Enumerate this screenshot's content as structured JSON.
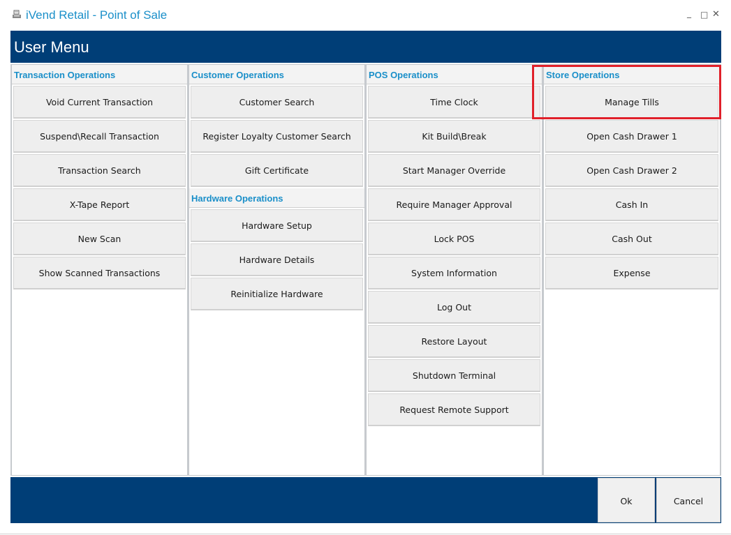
{
  "window": {
    "title": "iVend Retail - Point of Sale",
    "app_icon": "pos-receipt-icon",
    "controls": {
      "minimize": "_",
      "maximize": "□",
      "close": "✕"
    }
  },
  "header": {
    "title": "User Menu"
  },
  "columns": [
    {
      "sections": [
        {
          "title": "Transaction Operations",
          "buttons": [
            "Void Current Transaction",
            "Suspend\\Recall Transaction",
            "Transaction Search",
            "X-Tape Report",
            "New Scan",
            "Show Scanned Transactions"
          ]
        }
      ]
    },
    {
      "sections": [
        {
          "title": "Customer Operations",
          "buttons": [
            "Customer Search",
            "Register Loyalty Customer Search",
            "Gift Certificate"
          ]
        },
        {
          "title": "Hardware Operations",
          "buttons": [
            "Hardware Setup",
            "Hardware Details",
            "Reinitialize Hardware"
          ]
        }
      ]
    },
    {
      "sections": [
        {
          "title": "POS Operations",
          "buttons": [
            "Time Clock",
            "Kit Build\\Break",
            "Start Manager Override",
            "Require Manager Approval",
            "Lock POS",
            "System Information",
            "Log Out",
            "Restore Layout",
            "Shutdown Terminal",
            "Request Remote Support"
          ]
        }
      ]
    },
    {
      "sections": [
        {
          "title": "Store Operations",
          "buttons": [
            "Manage Tills",
            "Open Cash Drawer 1",
            "Open Cash Drawer 2",
            "Cash In",
            "Cash Out",
            "Expense"
          ]
        }
      ]
    }
  ],
  "footer": {
    "ok_label": "Ok",
    "cancel_label": "Cancel"
  },
  "colors": {
    "header_bg": "#003e77",
    "section_title": "#1a8fc9",
    "button_bg": "#eeeeee",
    "highlight": "#e0202a"
  }
}
